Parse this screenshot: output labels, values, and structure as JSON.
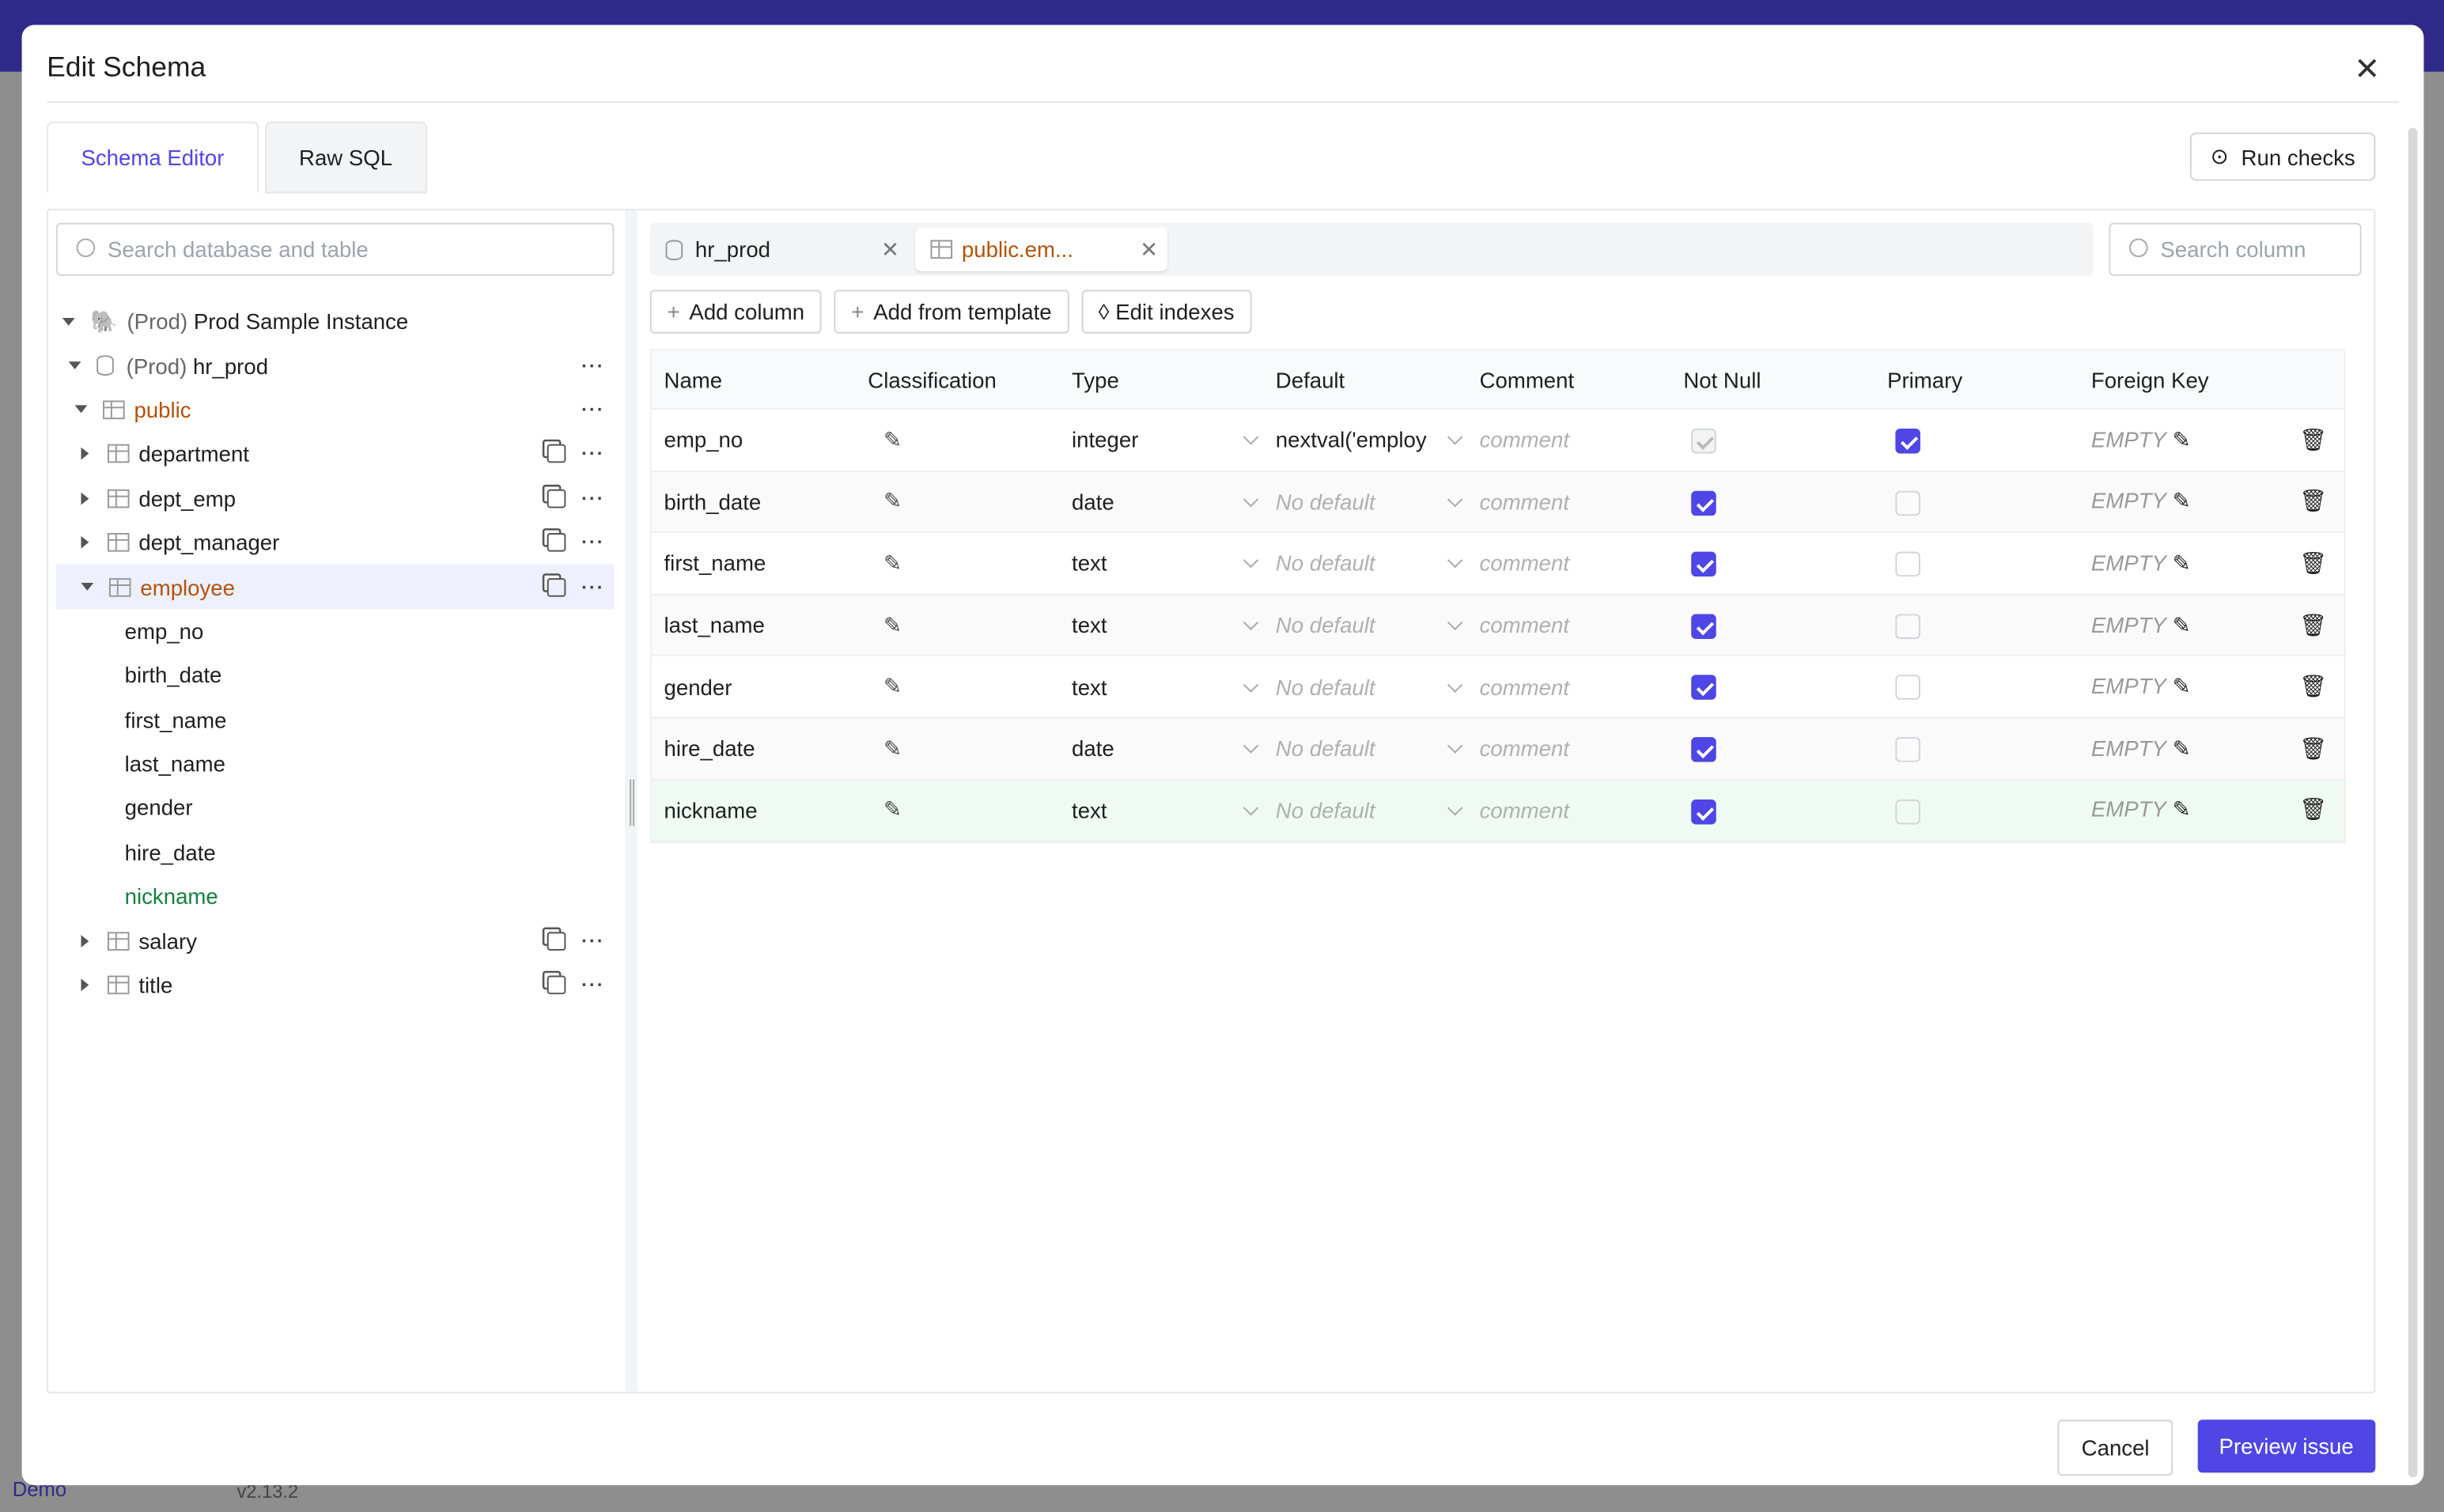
{
  "background": {
    "footer_left": "Demo",
    "version": "v2.13.2"
  },
  "modal": {
    "title": "Edit Schema",
    "tabs": [
      {
        "label": "Schema Editor",
        "active": true
      },
      {
        "label": "Raw SQL",
        "active": false
      }
    ],
    "run_checks": "Run checks",
    "cancel": "Cancel",
    "preview": "Preview issue"
  },
  "sidebar": {
    "search_placeholder": "Search database and table",
    "instance": {
      "env": "(Prod)",
      "name": "Prod Sample Instance"
    },
    "database": {
      "env": "(Prod)",
      "name": "hr_prod"
    },
    "schema": "public",
    "tables": [
      "department",
      "dept_emp",
      "dept_manager",
      "employee",
      "salary",
      "title"
    ],
    "selected_table": "employee",
    "columns": [
      "emp_no",
      "birth_date",
      "first_name",
      "last_name",
      "gender",
      "hire_date",
      "nickname"
    ]
  },
  "editor": {
    "file_tabs": [
      {
        "label": "hr_prod",
        "icon": "database-icon"
      },
      {
        "label": "public.em...",
        "icon": "table-icon",
        "active": true
      }
    ],
    "search_column_placeholder": "Search column",
    "toolbar": {
      "add_column": "Add column",
      "add_from_template": "Add from template",
      "edit_indexes": "Edit indexes"
    },
    "headers": [
      "Name",
      "Classification",
      "Type",
      "Default",
      "Comment",
      "Not Null",
      "Primary",
      "Foreign Key"
    ],
    "comment_placeholder": "comment",
    "fk_empty": "EMPTY",
    "rows": [
      {
        "name": "emp_no",
        "type": "integer",
        "default": "nextval('employ",
        "not_null": true,
        "not_null_disabled": true,
        "primary": true
      },
      {
        "name": "birth_date",
        "type": "date",
        "default": "No default",
        "not_null": true,
        "primary": false
      },
      {
        "name": "first_name",
        "type": "text",
        "default": "No default",
        "not_null": true,
        "primary": false
      },
      {
        "name": "last_name",
        "type": "text",
        "default": "No default",
        "not_null": true,
        "primary": false
      },
      {
        "name": "gender",
        "type": "text",
        "default": "No default",
        "not_null": true,
        "primary": false
      },
      {
        "name": "hire_date",
        "type": "date",
        "default": "No default",
        "not_null": true,
        "primary": false
      },
      {
        "name": "nickname",
        "type": "text",
        "default": "No default",
        "not_null": true,
        "primary": false,
        "new": true
      }
    ]
  },
  "colors": {
    "accent": "#4f46e5",
    "schema": "#b45309",
    "new_column": "#15803d",
    "new_row_bg": "#effbf2"
  }
}
